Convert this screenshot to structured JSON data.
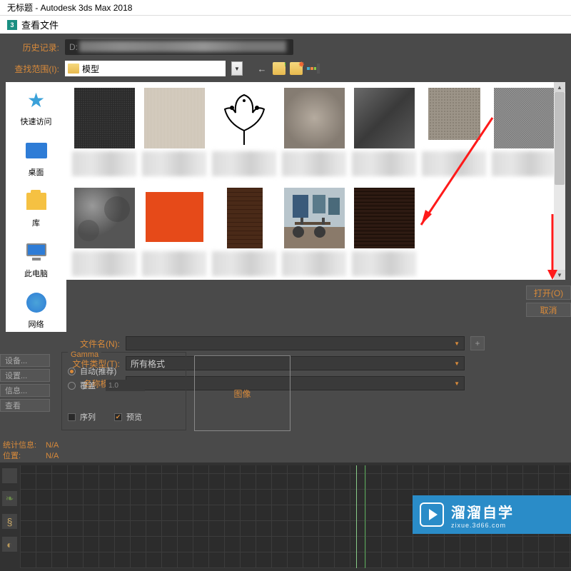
{
  "window": {
    "title": "无标题 - Autodesk 3ds Max 2018"
  },
  "dialog": {
    "title": "查看文件",
    "history_label": "历史记录:",
    "history_value": "D:",
    "lookin_label": "查找范围(I):",
    "lookin_value": "模型"
  },
  "sidebar": {
    "items": [
      {
        "label": "快速访问",
        "icon": "star"
      },
      {
        "label": "桌面",
        "icon": "desktop"
      },
      {
        "label": "库",
        "icon": "library"
      },
      {
        "label": "此电脑",
        "icon": "pc"
      },
      {
        "label": "网络",
        "icon": "network"
      }
    ]
  },
  "fileFields": {
    "filename_label": "文件名(N):",
    "filetype_label": "文件类型(T):",
    "filetype_value": "所有格式",
    "template_label": "名称模板:"
  },
  "actions": {
    "open": "打开(O)",
    "cancel": "取消",
    "plus": "+"
  },
  "gamma": {
    "title": "Gamma",
    "auto": "自动(推荐)",
    "override": "覆盖",
    "override_val": "1.0",
    "sequence": "序列",
    "preview": "预览",
    "preview_box": "图像"
  },
  "sideButtons": {
    "device": "设备...",
    "settings": "设置...",
    "info": "信息...",
    "view": "查看"
  },
  "stats": {
    "stat_label": "统计信息:",
    "stat_val": "N/A",
    "loc_label": "位置:",
    "loc_val": "N/A"
  },
  "watermark": {
    "brand": "溜溜自学",
    "url": "zixue.3d66.com"
  }
}
